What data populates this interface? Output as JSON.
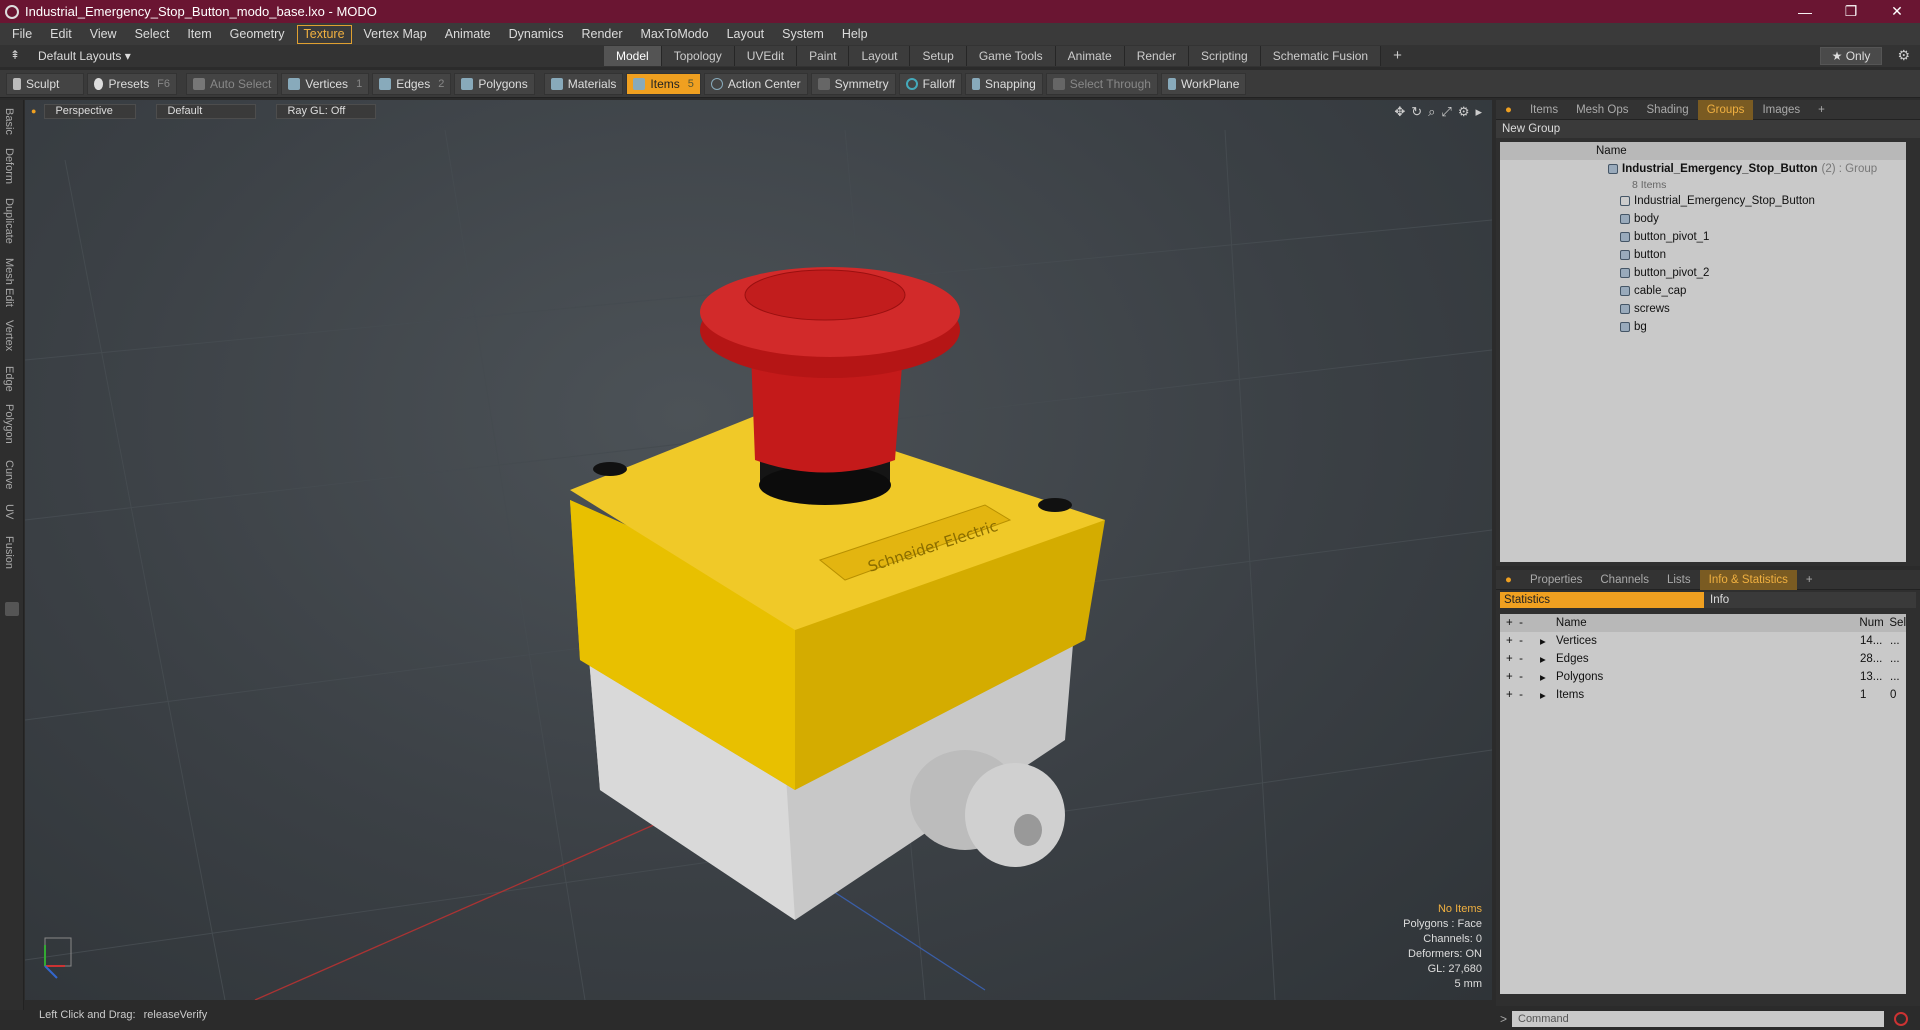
{
  "window": {
    "title": "Industrial_Emergency_Stop_Button_modo_base.lxo - MODO"
  },
  "menu": [
    "File",
    "Edit",
    "View",
    "Select",
    "Item",
    "Geometry",
    "Texture",
    "Vertex Map",
    "Animate",
    "Dynamics",
    "Render",
    "MaxToModo",
    "Layout",
    "System",
    "Help"
  ],
  "menu_active": "Texture",
  "layouts": {
    "label": "Default Layouts ▾"
  },
  "layout_tabs": [
    "Model",
    "Topology",
    "UVEdit",
    "Paint",
    "Layout",
    "Setup",
    "Game Tools",
    "Animate",
    "Render",
    "Scripting",
    "Schematic Fusion"
  ],
  "layout_tab_active": "Model",
  "only_button": "★ Only",
  "toolbar": {
    "sculpt": "Sculpt",
    "presets": "Presets",
    "presets_key": "F6",
    "auto_select": "Auto Select",
    "vertices": "Vertices",
    "vertices_num": "1",
    "edges": "Edges",
    "edges_num": "2",
    "polygons": "Polygons",
    "materials": "Materials",
    "items": "Items",
    "items_num": "5",
    "action_center": "Action Center",
    "symmetry": "Symmetry",
    "falloff": "Falloff",
    "snapping": "Snapping",
    "select_through": "Select Through",
    "workplane": "WorkPlane"
  },
  "left_tabs": [
    "Basic",
    "Deform",
    "Duplicate",
    "Mesh Edit",
    "Vertex",
    "Edge",
    "Polygon",
    "Curve",
    "UV",
    "Fusion"
  ],
  "viewport": {
    "view": "Perspective",
    "shading": "Default",
    "raygl": "Ray GL: Off",
    "info": {
      "no_items": "No Items",
      "polygons": "Polygons : Face",
      "channels": "Channels: 0",
      "deformers": "Deformers: ON",
      "gl": "GL: 27,680",
      "scale": "5 mm"
    },
    "logo_text": "Schneider Electric"
  },
  "status": {
    "hint": "Left Click and Drag:",
    "action": "releaseVerify"
  },
  "scene_panel": {
    "tabs": [
      "Items",
      "Mesh Ops",
      "Shading",
      "Groups",
      "Images"
    ],
    "active_tab": "Groups",
    "new_group": "New Group",
    "col_name": "Name",
    "group_name": "Industrial_Emergency_Stop_Button",
    "group_suffix": "(2) : Group",
    "group_count": "8 Items",
    "items": [
      "Industrial_Emergency_Stop_Button",
      "body",
      "button_pivot_1",
      "button",
      "button_pivot_2",
      "cable_cap",
      "screws",
      "bg"
    ]
  },
  "stats_panel": {
    "tabs": [
      "Properties",
      "Channels",
      "Lists",
      "Info & Statistics"
    ],
    "active_tab": "Info & Statistics",
    "sub_statistics": "Statistics",
    "sub_info": "Info",
    "col_name": "Name",
    "col_num": "Num",
    "col_sel": "Sel",
    "rows": [
      {
        "name": "Vertices",
        "num": "14...",
        "sel": "..."
      },
      {
        "name": "Edges",
        "num": "28...",
        "sel": "..."
      },
      {
        "name": "Polygons",
        "num": "13...",
        "sel": "..."
      },
      {
        "name": "Items",
        "num": "1",
        "sel": "0"
      }
    ]
  },
  "command": {
    "placeholder": "Command"
  },
  "colors": {
    "accent": "#f0a020",
    "titlebar": "#6a1532"
  }
}
